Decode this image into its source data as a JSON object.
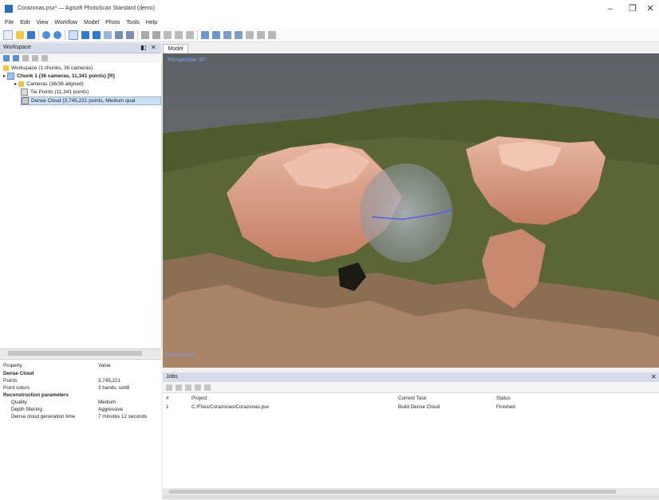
{
  "app": {
    "title": "Corazonas.psx* — Agisoft PhotoScan Standard (demo)",
    "window_controls": [
      "–",
      "❐",
      "✕"
    ]
  },
  "menu": [
    "File",
    "Edit",
    "View",
    "Workflow",
    "Model",
    "Photo",
    "Tools",
    "Help"
  ],
  "toolbar_icons": [
    "new-icon",
    "open-icon",
    "save-icon",
    "undo-icon",
    "redo-icon",
    "select-icon",
    "rotate-icon",
    "zoom-icon",
    "move-icon",
    "region-icon",
    "resize-icon",
    "cut-icon",
    "crop-icon",
    "rectangle-select-icon",
    "circle-select-icon",
    "free-select-icon",
    "ruler-icon",
    "points-icon",
    "mesh-icon",
    "texture-icon",
    "grid-icon",
    "camera-icon",
    "settings-icon"
  ],
  "workspace": {
    "title": "Workspace",
    "controls": [
      "◧",
      "✕"
    ],
    "items": [
      {
        "label": "Workspace (1 chunks, 36 cameras)",
        "level": 0,
        "icon": "folder-icon"
      },
      {
        "label": "Chunk 1 (36 cameras, 11,341 points) [R]",
        "level": 0,
        "icon": "chunk-icon",
        "bold": true
      },
      {
        "label": "Cameras (36/36 aligned)",
        "level": 1,
        "icon": "folder-icon"
      },
      {
        "label": "Tie Points (11,341 points)",
        "level": 1,
        "icon": "points-icon"
      },
      {
        "label": "Dense Cloud (3,745,221 points, Medium qual",
        "level": 1,
        "icon": "dense-cloud-icon",
        "selected": true
      }
    ]
  },
  "properties": {
    "header_property": "Property",
    "header_value": "Value",
    "rows": [
      {
        "label": "Dense Cloud",
        "value": "",
        "bold": true,
        "indent": 0
      },
      {
        "label": "Points",
        "value": "3,745,221",
        "indent": 0
      },
      {
        "label": "Point colors",
        "value": "3 bands, uint8",
        "indent": 0
      },
      {
        "label": "Reconstruction parameters",
        "value": "",
        "bold": true,
        "indent": 0
      },
      {
        "label": "Quality",
        "value": "Medium",
        "indent": 1
      },
      {
        "label": "Depth filtering",
        "value": "Aggressive",
        "indent": 1
      },
      {
        "label": "Dense cloud generation time",
        "value": "7 minutes 12 seconds",
        "indent": 1
      }
    ]
  },
  "model": {
    "tab": "Model",
    "label_top": "Perspective 30°",
    "label_bottom": "Dense Cloud",
    "colors": {
      "sky": "#6b6e72",
      "terrain": "#4e5a2c",
      "rock": "#d9a48e",
      "selection": "#a0a7b7",
      "marker": "#5560e8"
    }
  },
  "jobs": {
    "title": "Jobs",
    "close": "✕",
    "columns": [
      "#",
      "Project",
      "Current Task",
      "Status"
    ],
    "rows": [
      {
        "num": "1",
        "project": "C:/Files/Corazonas/Corazonas.psx",
        "task": "Build Dense Cloud",
        "status": "Finished"
      }
    ]
  }
}
